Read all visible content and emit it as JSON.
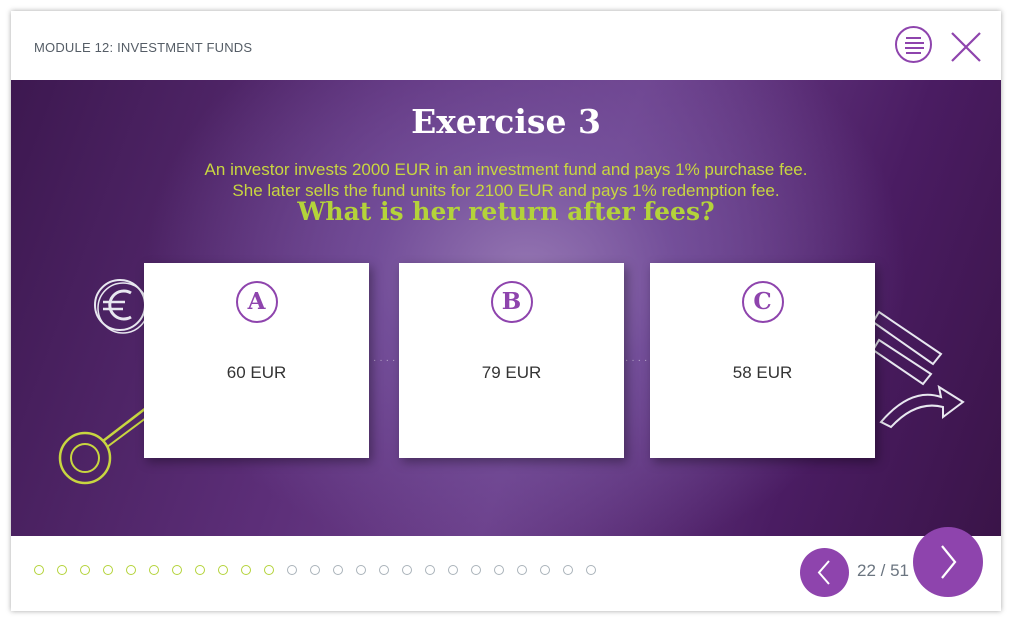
{
  "header": {
    "module_title": "MODULE 12: INVESTMENT FUNDS",
    "menu_icon": "menu-lines-icon",
    "close_icon": "close-icon"
  },
  "exercise": {
    "title": "Exercise 3",
    "question_line1": "An investor invests 2000 EUR in an investment fund and pays 1% purchase fee.",
    "question_line2": "She later sells the fund units for 2100 EUR and pays 1% redemption fee.",
    "question": "What is her return after fees?"
  },
  "options": [
    {
      "letter": "A",
      "value": "60 EUR"
    },
    {
      "letter": "B",
      "value": "79 EUR"
    },
    {
      "letter": "C",
      "value": "58 EUR"
    }
  ],
  "footer": {
    "progress_completed": 11,
    "progress_total": 25,
    "page_counter": "22 / 51",
    "prev_icon": "chevron-left-icon",
    "next_icon": "chevron-right-icon"
  },
  "colors": {
    "accent_purple": "#8e44ad",
    "accent_green": "#b4d33a",
    "background_purple": "#5c2e78"
  }
}
